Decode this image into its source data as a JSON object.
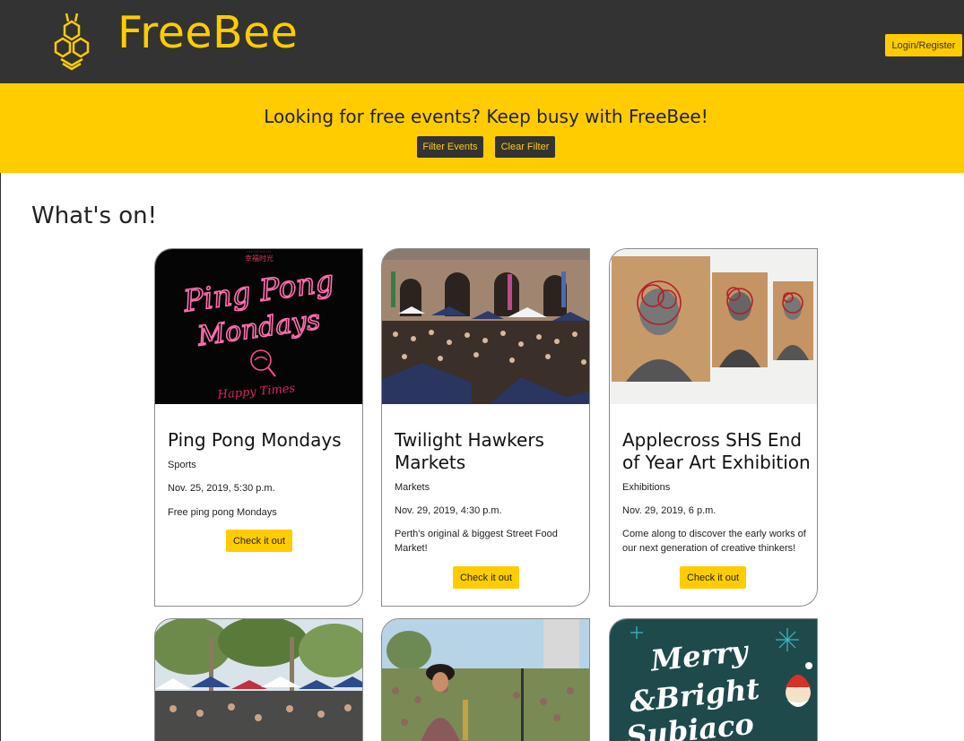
{
  "brand": {
    "name": "FreeBee",
    "login_label": "Login/Register"
  },
  "hero": {
    "tagline": "Looking for free events? Keep busy with FreeBee!",
    "filter_label": "Filter Events",
    "clear_label": "Clear Filter"
  },
  "section_title": "What's on!",
  "events": [
    {
      "title": "Ping Pong Mondays",
      "category": "Sports",
      "date": "Nov. 25, 2019, 5:30 p.m.",
      "description": "Free ping pong Mondays",
      "cta": "Check it out",
      "image_text": "Ping Pong Mondays",
      "image_caption": "Happy Times"
    },
    {
      "title": "Twilight Hawkers Markets",
      "category": "Markets",
      "date": "Nov. 29, 2019, 4:30 p.m.",
      "description": "Perth's original & biggest Street Food Market!",
      "cta": "Check it out"
    },
    {
      "title": "Applecross SHS End of Year Art Exhibition",
      "category": "Exhibitions",
      "date": "Nov. 29, 2019, 6 p.m.",
      "description": "Come along to discover the early works of our next generation of creative thinkers!",
      "cta": "Check it out"
    }
  ],
  "more_events": [
    {
      "image": "park-market"
    },
    {
      "image": "saxophone-concert"
    },
    {
      "image_text": "Merry & Bright Subiaco"
    }
  ],
  "colors": {
    "accent": "#ffcc00",
    "dark": "#333333"
  }
}
